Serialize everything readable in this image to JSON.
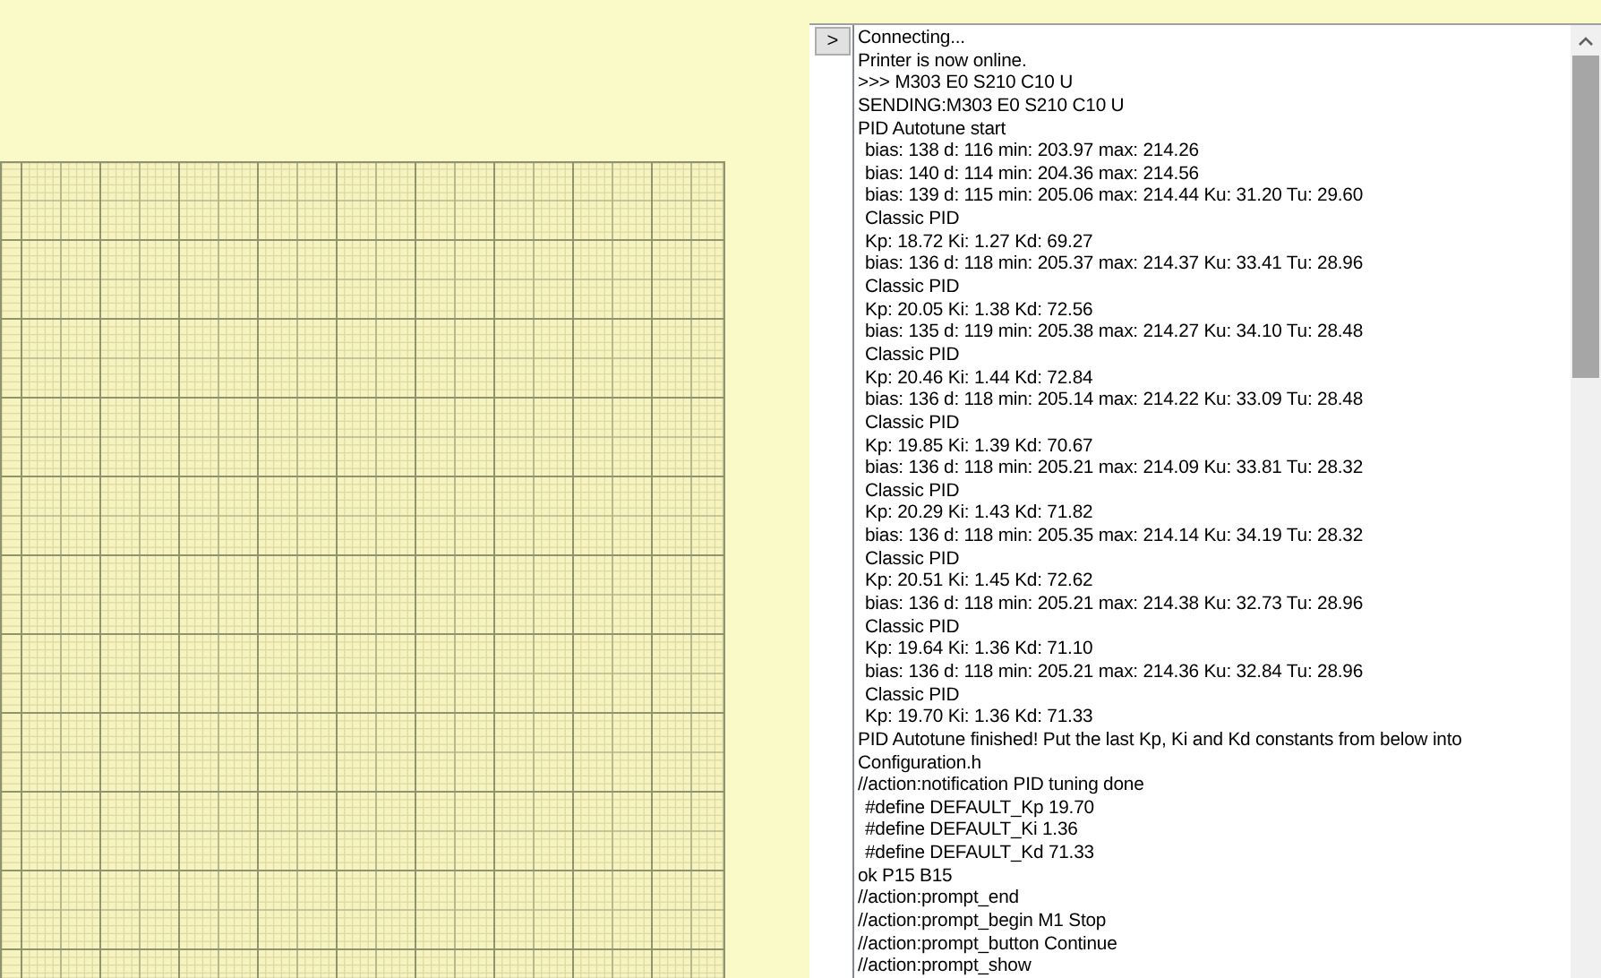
{
  "send_button": {
    "label": ">"
  },
  "console": {
    "lines": [
      {
        "text": "Connecting...",
        "indent": false
      },
      {
        "text": "Printer is now online.",
        "indent": false
      },
      {
        "text": ">>> M303 E0 S210 C10 U",
        "indent": false
      },
      {
        "text": "SENDING:M303 E0 S210 C10 U",
        "indent": false
      },
      {
        "text": "PID Autotune start",
        "indent": false
      },
      {
        "text": "bias: 138 d: 116 min: 203.97 max: 214.26",
        "indent": true
      },
      {
        "text": "bias: 140 d: 114 min: 204.36 max: 214.56",
        "indent": true
      },
      {
        "text": "bias: 139 d: 115 min: 205.06 max: 214.44 Ku: 31.20 Tu: 29.60",
        "indent": true
      },
      {
        "text": "Classic PID",
        "indent": true
      },
      {
        "text": "Kp: 18.72 Ki: 1.27 Kd: 69.27",
        "indent": true
      },
      {
        "text": "bias: 136 d: 118 min: 205.37 max: 214.37 Ku: 33.41 Tu: 28.96",
        "indent": true
      },
      {
        "text": "Classic PID",
        "indent": true
      },
      {
        "text": "Kp: 20.05 Ki: 1.38 Kd: 72.56",
        "indent": true
      },
      {
        "text": "bias: 135 d: 119 min: 205.38 max: 214.27 Ku: 34.10 Tu: 28.48",
        "indent": true
      },
      {
        "text": "Classic PID",
        "indent": true
      },
      {
        "text": "Kp: 20.46 Ki: 1.44 Kd: 72.84",
        "indent": true
      },
      {
        "text": "bias: 136 d: 118 min: 205.14 max: 214.22 Ku: 33.09 Tu: 28.48",
        "indent": true
      },
      {
        "text": "Classic PID",
        "indent": true
      },
      {
        "text": "Kp: 19.85 Ki: 1.39 Kd: 70.67",
        "indent": true
      },
      {
        "text": "bias: 136 d: 118 min: 205.21 max: 214.09 Ku: 33.81 Tu: 28.32",
        "indent": true
      },
      {
        "text": "Classic PID",
        "indent": true
      },
      {
        "text": "Kp: 20.29 Ki: 1.43 Kd: 71.82",
        "indent": true
      },
      {
        "text": "bias: 136 d: 118 min: 205.35 max: 214.14 Ku: 34.19 Tu: 28.32",
        "indent": true
      },
      {
        "text": "Classic PID",
        "indent": true
      },
      {
        "text": "Kp: 20.51 Ki: 1.45 Kd: 72.62",
        "indent": true
      },
      {
        "text": "bias: 136 d: 118 min: 205.21 max: 214.38 Ku: 32.73 Tu: 28.96",
        "indent": true
      },
      {
        "text": "Classic PID",
        "indent": true
      },
      {
        "text": "Kp: 19.64 Ki: 1.36 Kd: 71.10",
        "indent": true
      },
      {
        "text": "bias: 136 d: 118 min: 205.21 max: 214.36 Ku: 32.84 Tu: 28.96",
        "indent": true
      },
      {
        "text": "Classic PID",
        "indent": true
      },
      {
        "text": "Kp: 19.70 Ki: 1.36 Kd: 71.33",
        "indent": true
      },
      {
        "text": "PID Autotune finished! Put the last Kp, Ki and Kd constants from below into",
        "indent": false
      },
      {
        "text": "Configuration.h",
        "indent": false
      },
      {
        "text": "//action:notification PID tuning done",
        "indent": false
      },
      {
        "text": "#define DEFAULT_Kp 19.70",
        "indent": true
      },
      {
        "text": "#define DEFAULT_Ki 1.36",
        "indent": true
      },
      {
        "text": "#define DEFAULT_Kd 71.33",
        "indent": true
      },
      {
        "text": "ok P15 B15",
        "indent": false
      },
      {
        "text": "//action:prompt_end",
        "indent": false
      },
      {
        "text": "//action:prompt_begin M1 Stop",
        "indent": false
      },
      {
        "text": "//action:prompt_button Continue",
        "indent": false
      },
      {
        "text": "//action:prompt_show",
        "indent": false
      }
    ]
  }
}
